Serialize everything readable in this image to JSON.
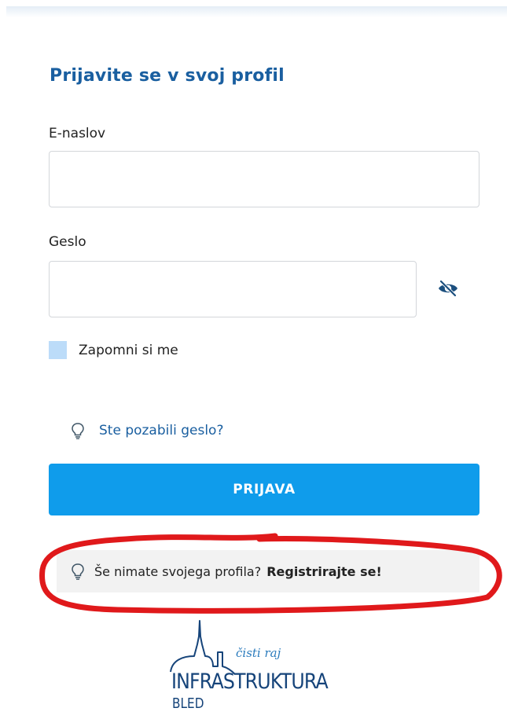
{
  "form": {
    "title": "Prijavite se v svoj profil",
    "email_label": "E-naslov",
    "email_value": "",
    "password_label": "Geslo",
    "password_value": "",
    "remember_label": "Zapomni si me",
    "remember_checked": false,
    "forgot_link": "Ste pozabili geslo?",
    "submit_label": "PRIJAVA"
  },
  "register": {
    "prompt": "Še nimate svojega profila?",
    "link": "Registrirajte se!"
  },
  "logo": {
    "tagline": "čisti raj",
    "name": "INFRASTRUKTURA",
    "sub": "BLED"
  },
  "icons": {
    "password_toggle": "eye-slash-icon",
    "forgot_hint": "lightbulb-icon",
    "register_hint": "lightbulb-icon"
  },
  "colors": {
    "title": "#1a5fa0",
    "link": "#1a5fa0",
    "button": "#0f9ceb",
    "checkbox": "#bcdcf9",
    "annotation": "#e0191b",
    "logo": "#16447a"
  }
}
